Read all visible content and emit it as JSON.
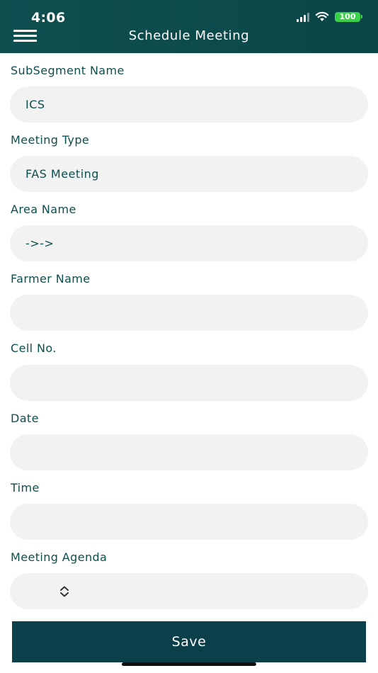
{
  "status_bar": {
    "time": "4:06",
    "battery": "100",
    "icons": [
      "signal-icon",
      "wifi-icon",
      "battery-icon"
    ]
  },
  "header": {
    "title": "Schedule Meeting",
    "menu_icon": "hamburger-menu-icon",
    "background_color": "#0c4a4b"
  },
  "form": {
    "fields": [
      {
        "label": "SubSegment Name",
        "value": "ICS"
      },
      {
        "label": "Meeting Type",
        "value": "FAS Meeting"
      },
      {
        "label": "Area Name",
        "value": "->->"
      },
      {
        "label": "Farmer Name",
        "value": ""
      },
      {
        "label": "Cell No.",
        "value": ""
      },
      {
        "label": "Date",
        "value": ""
      },
      {
        "label": "Time",
        "value": ""
      },
      {
        "label": "Meeting Agenda",
        "value": "",
        "icon": "up-down-chevron-icon"
      }
    ]
  },
  "save_button": {
    "label": "Save",
    "color": "#0b3f4a"
  },
  "colors": {
    "label_text": "#0d4f4d",
    "field_background": "#f2f2f2"
  }
}
